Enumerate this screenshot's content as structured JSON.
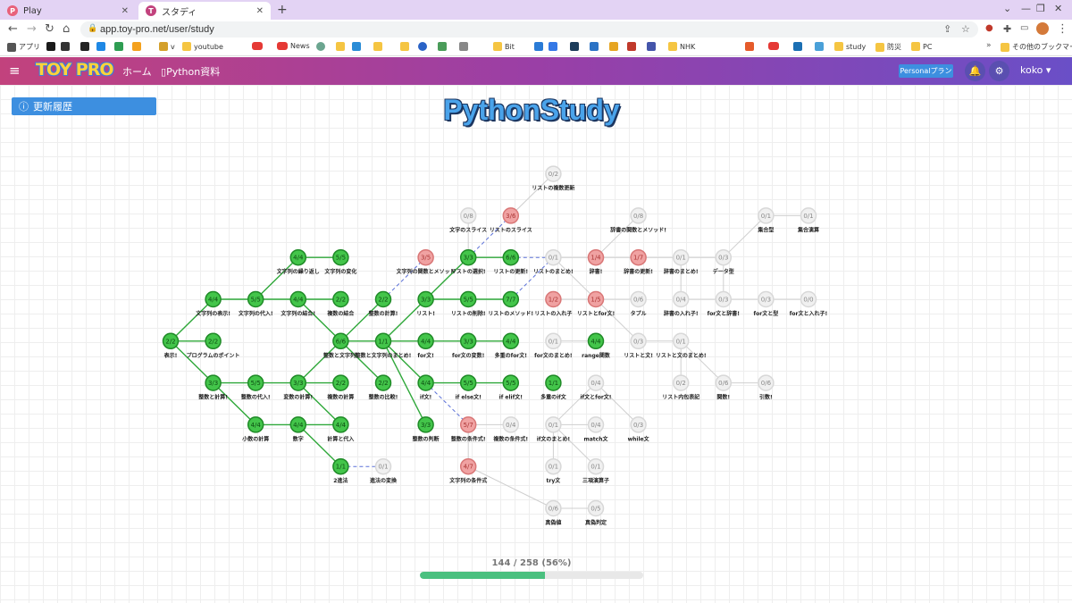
{
  "browser": {
    "tabs": [
      {
        "title": "Play",
        "icon": "play-app-icon",
        "active": false
      },
      {
        "title": "スタディ",
        "icon": "toypro-icon",
        "active": true
      }
    ],
    "url": "app.toy-pro.net/user/study",
    "bookmarks": [
      {
        "label": "アプリ",
        "icon": "apps-grid-icon"
      },
      {
        "label": "",
        "icon": "h-icon"
      },
      {
        "label": "",
        "icon": "amazon-icon"
      },
      {
        "label": "",
        "icon": "wordpress-icon"
      },
      {
        "label": "",
        "icon": "ie-icon"
      },
      {
        "label": "",
        "icon": "sheets-icon"
      },
      {
        "label": "",
        "icon": "star-icon"
      },
      {
        "label": "v",
        "icon": "v-icon"
      },
      {
        "label": "youtube",
        "icon": "folder-icon"
      },
      {
        "label": "",
        "icon": "youtube-icon"
      },
      {
        "label": "News",
        "icon": "youtube-icon"
      },
      {
        "label": "",
        "icon": "chatgpt-icon"
      },
      {
        "label": "",
        "icon": "folder-icon"
      },
      {
        "label": "",
        "icon": "music-icon"
      },
      {
        "label": "",
        "icon": "folder-icon"
      },
      {
        "label": "",
        "icon": "folder-icon"
      },
      {
        "label": "",
        "icon": "globe-icon"
      },
      {
        "label": "",
        "icon": "broadcast-icon"
      },
      {
        "label": "",
        "icon": "apple-icon"
      },
      {
        "label": "Bit",
        "icon": "folder-icon"
      },
      {
        "label": "",
        "icon": "cube-icon"
      },
      {
        "label": "",
        "icon": "translate-icon"
      },
      {
        "label": "",
        "icon": "hex-icon"
      },
      {
        "label": "",
        "icon": "chart-icon"
      },
      {
        "label": "",
        "icon": "pinwheel-icon"
      },
      {
        "label": "",
        "icon": "face-icon"
      },
      {
        "label": "",
        "icon": "person-icon"
      },
      {
        "label": "NHK",
        "icon": "folder-icon"
      },
      {
        "label": "",
        "icon": "fire-icon"
      },
      {
        "label": "",
        "icon": "youtube-icon"
      },
      {
        "label": "",
        "icon": "v-square-icon"
      },
      {
        "label": "",
        "icon": "link-icon"
      },
      {
        "label": "study",
        "icon": "folder-icon"
      },
      {
        "label": "防災",
        "icon": "folder-icon"
      },
      {
        "label": "PC",
        "icon": "folder-icon"
      },
      {
        "label": "その他のブックマーク",
        "icon": "folder-icon"
      }
    ]
  },
  "header": {
    "logo": "TOY PRO",
    "nav": [
      {
        "label": "ホーム"
      },
      {
        "label": "Python資料"
      }
    ],
    "plan_button": "Personalプラン",
    "user": "koko",
    "colors": {
      "gradient_start": "#c2427d",
      "gradient_end": "#6a4fc7",
      "accent": "#3d8fe0"
    }
  },
  "page": {
    "history_button": "更新履歴",
    "title": "PythonStudy",
    "progress": {
      "text": "144 / 258 (56%)",
      "done": 144,
      "total": 258,
      "percent": 56
    }
  },
  "skill_tree": {
    "status_colors": {
      "complete": "#43c54a",
      "partial": "#f0a2a2",
      "locked": "#f0f0f0"
    },
    "nodes": [
      {
        "id": "n1",
        "count": "2/2",
        "label": "表示!",
        "status": "complete",
        "col": 0,
        "row": 6
      },
      {
        "id": "n2",
        "count": "2/2",
        "label": "プログラムのポイント",
        "status": "complete",
        "col": 1,
        "row": 6
      },
      {
        "id": "n3",
        "count": "4/4",
        "label": "文字列の表示!",
        "status": "complete",
        "col": 1,
        "row": 5
      },
      {
        "id": "n4",
        "count": "3/3",
        "label": "整数と計算!",
        "status": "complete",
        "col": 1,
        "row": 7
      },
      {
        "id": "n5",
        "count": "5/5",
        "label": "文字列の代入!",
        "status": "complete",
        "col": 2,
        "row": 5
      },
      {
        "id": "n6",
        "count": "5/5",
        "label": "整数の代入!",
        "status": "complete",
        "col": 2,
        "row": 7
      },
      {
        "id": "n7",
        "count": "4/4",
        "label": "小数の計算",
        "status": "complete",
        "col": 2,
        "row": 8
      },
      {
        "id": "n8",
        "count": "4/4",
        "label": "文字列の繰り返し",
        "status": "complete",
        "col": 3,
        "row": 4
      },
      {
        "id": "n9",
        "count": "4/4",
        "label": "文字列の結合!",
        "status": "complete",
        "col": 3,
        "row": 5
      },
      {
        "id": "n10",
        "count": "3/3",
        "label": "変数の計算!",
        "status": "complete",
        "col": 3,
        "row": 7
      },
      {
        "id": "n11",
        "count": "4/4",
        "label": "数字",
        "status": "complete",
        "col": 3,
        "row": 8
      },
      {
        "id": "n12",
        "count": "5/5",
        "label": "文字列の変化",
        "status": "complete",
        "col": 4,
        "row": 4
      },
      {
        "id": "n13",
        "count": "2/2",
        "label": "複数の結合",
        "status": "complete",
        "col": 4,
        "row": 5
      },
      {
        "id": "n14",
        "count": "6/6",
        "label": "整数と文字列!",
        "status": "complete",
        "col": 4,
        "row": 6
      },
      {
        "id": "n15",
        "count": "2/2",
        "label": "複数の計算",
        "status": "complete",
        "col": 4,
        "row": 7
      },
      {
        "id": "n16",
        "count": "4/4",
        "label": "計算と代入",
        "status": "complete",
        "col": 4,
        "row": 8
      },
      {
        "id": "n17",
        "count": "1/1",
        "label": "2進法",
        "status": "complete",
        "col": 4,
        "row": 9
      },
      {
        "id": "n18",
        "count": "0/1",
        "label": "進法の変換",
        "status": "locked",
        "col": 5,
        "row": 9
      },
      {
        "id": "n19",
        "count": "2/2",
        "label": "整数の計算!",
        "status": "complete",
        "col": 5,
        "row": 5
      },
      {
        "id": "n20",
        "count": "1/1",
        "label": "整数と文字列のまとめ!",
        "status": "complete",
        "col": 5,
        "row": 6
      },
      {
        "id": "n21",
        "count": "2/2",
        "label": "整数の比較!",
        "status": "complete",
        "col": 5,
        "row": 7
      },
      {
        "id": "n22",
        "count": "3/5",
        "label": "文字列の関数とメソッド",
        "status": "partial",
        "col": 6,
        "row": 4
      },
      {
        "id": "n23",
        "count": "3/3",
        "label": "リスト!",
        "status": "complete",
        "col": 6,
        "row": 5
      },
      {
        "id": "n24",
        "count": "4/4",
        "label": "for文!",
        "status": "complete",
        "col": 6,
        "row": 6
      },
      {
        "id": "n25",
        "count": "4/4",
        "label": "if文!",
        "status": "complete",
        "col": 6,
        "row": 7
      },
      {
        "id": "n26",
        "count": "3/3",
        "label": "整数の判断",
        "status": "complete",
        "col": 6,
        "row": 8
      },
      {
        "id": "n27",
        "count": "0/8",
        "label": "文字のスライス",
        "status": "locked",
        "col": 7,
        "row": 3
      },
      {
        "id": "n28",
        "count": "3/3",
        "label": "リストの選択!",
        "status": "complete",
        "col": 7,
        "row": 4
      },
      {
        "id": "n29",
        "count": "5/5",
        "label": "リストの削除!",
        "status": "complete",
        "col": 7,
        "row": 5
      },
      {
        "id": "n30",
        "count": "3/3",
        "label": "for文の変数!",
        "status": "complete",
        "col": 7,
        "row": 6
      },
      {
        "id": "n31",
        "count": "5/5",
        "label": "if else文!",
        "status": "complete",
        "col": 7,
        "row": 7
      },
      {
        "id": "n32",
        "count": "5/7",
        "label": "整数の条件式!",
        "status": "partial",
        "col": 7,
        "row": 8
      },
      {
        "id": "n33",
        "count": "4/7",
        "label": "文字列の条件式",
        "status": "partial",
        "col": 7,
        "row": 9
      },
      {
        "id": "n34",
        "count": "3/6",
        "label": "リストのスライス",
        "status": "partial",
        "col": 8,
        "row": 3
      },
      {
        "id": "n35",
        "count": "6/6",
        "label": "リストの更新!",
        "status": "complete",
        "col": 8,
        "row": 4
      },
      {
        "id": "n36",
        "count": "7/7",
        "label": "リストのメソッド!",
        "status": "complete",
        "col": 8,
        "row": 5
      },
      {
        "id": "n37",
        "count": "4/4",
        "label": "多重のfor文!",
        "status": "complete",
        "col": 8,
        "row": 6
      },
      {
        "id": "n38",
        "count": "5/5",
        "label": "if elif文!",
        "status": "complete",
        "col": 8,
        "row": 7
      },
      {
        "id": "n39",
        "count": "0/4",
        "label": "複数の条件式!",
        "status": "locked",
        "col": 8,
        "row": 8
      },
      {
        "id": "n40",
        "count": "0/2",
        "label": "リストの複数更新",
        "status": "locked",
        "col": 9,
        "row": 2
      },
      {
        "id": "n41",
        "count": "0/1",
        "label": "リストのまとめ!",
        "status": "locked",
        "col": 9,
        "row": 4
      },
      {
        "id": "n42",
        "count": "1/2",
        "label": "リストの入れ子",
        "status": "partial",
        "col": 9,
        "row": 5
      },
      {
        "id": "n43",
        "count": "0/1",
        "label": "for文のまとめ!",
        "status": "locked",
        "col": 9,
        "row": 6
      },
      {
        "id": "n44",
        "count": "1/1",
        "label": "多重のif文",
        "status": "complete",
        "col": 9,
        "row": 7
      },
      {
        "id": "n45",
        "count": "0/1",
        "label": "if文のまとめ!",
        "status": "locked",
        "col": 9,
        "row": 8
      },
      {
        "id": "n46",
        "count": "0/1",
        "label": "try文",
        "status": "locked",
        "col": 9,
        "row": 9
      },
      {
        "id": "n47",
        "count": "0/6",
        "label": "真偽値",
        "status": "locked",
        "col": 9,
        "row": 10
      },
      {
        "id": "n48",
        "count": "1/4",
        "label": "辞書!",
        "status": "partial",
        "col": 10,
        "row": 4
      },
      {
        "id": "n49",
        "count": "1/5",
        "label": "リストとfor文!",
        "status": "partial",
        "col": 10,
        "row": 5
      },
      {
        "id": "n50",
        "count": "4/4",
        "label": "range関数",
        "status": "complete",
        "col": 10,
        "row": 6
      },
      {
        "id": "n51",
        "count": "0/4",
        "label": "if文とfor文!",
        "status": "locked",
        "col": 10,
        "row": 7
      },
      {
        "id": "n52",
        "count": "0/4",
        "label": "match文",
        "status": "locked",
        "col": 10,
        "row": 8
      },
      {
        "id": "n53",
        "count": "0/1",
        "label": "三項演算子",
        "status": "locked",
        "col": 10,
        "row": 9
      },
      {
        "id": "n54",
        "count": "0/5",
        "label": "真偽判定",
        "status": "locked",
        "col": 10,
        "row": 10
      },
      {
        "id": "n55",
        "count": "0/8",
        "label": "辞書の関数とメソッド!",
        "status": "locked",
        "col": 11,
        "row": 3
      },
      {
        "id": "n56",
        "count": "1/7",
        "label": "辞書の更新!",
        "status": "partial",
        "col": 11,
        "row": 4
      },
      {
        "id": "n57",
        "count": "0/6",
        "label": "タプル",
        "status": "locked",
        "col": 11,
        "row": 5
      },
      {
        "id": "n58",
        "count": "0/3",
        "label": "リストと文!",
        "status": "locked",
        "col": 11,
        "row": 6
      },
      {
        "id": "n59",
        "count": "0/3",
        "label": "while文",
        "status": "locked",
        "col": 11,
        "row": 8
      },
      {
        "id": "n60",
        "count": "0/1",
        "label": "辞書のまとめ!",
        "status": "locked",
        "col": 12,
        "row": 4
      },
      {
        "id": "n61",
        "count": "0/4",
        "label": "辞書の入れ子!",
        "status": "locked",
        "col": 12,
        "row": 5
      },
      {
        "id": "n62",
        "count": "0/1",
        "label": "リストと文のまとめ!",
        "status": "locked",
        "col": 12,
        "row": 6
      },
      {
        "id": "n63",
        "count": "0/2",
        "label": "リスト内包表記",
        "status": "locked",
        "col": 12,
        "row": 7
      },
      {
        "id": "n64",
        "count": "0/3",
        "label": "データ型",
        "status": "locked",
        "col": 13,
        "row": 4
      },
      {
        "id": "n65",
        "count": "0/3",
        "label": "for文と辞書!",
        "status": "locked",
        "col": 13,
        "row": 5
      },
      {
        "id": "n66",
        "count": "0/6",
        "label": "関数!",
        "status": "locked",
        "col": 13,
        "row": 7
      },
      {
        "id": "n67",
        "count": "0/1",
        "label": "集合型",
        "status": "locked",
        "col": 14,
        "row": 3
      },
      {
        "id": "n68",
        "count": "0/3",
        "label": "for文と型",
        "status": "locked",
        "col": 14,
        "row": 5
      },
      {
        "id": "n69",
        "count": "0/6",
        "label": "引数!",
        "status": "locked",
        "col": 14,
        "row": 7
      },
      {
        "id": "n70",
        "count": "0/1",
        "label": "集合演算",
        "status": "locked",
        "col": 15,
        "row": 3
      },
      {
        "id": "n71",
        "count": "0/0",
        "label": "for文と入れ子!",
        "status": "locked",
        "col": 15,
        "row": 5
      }
    ],
    "edges": [
      [
        "n1",
        "n3",
        "solid"
      ],
      [
        "n1",
        "n2",
        "solid"
      ],
      [
        "n1",
        "n4",
        "solid"
      ],
      [
        "n3",
        "n5",
        "solid"
      ],
      [
        "n4",
        "n6",
        "solid"
      ],
      [
        "n4",
        "n7",
        "solid"
      ],
      [
        "n5",
        "n8",
        "solid"
      ],
      [
        "n5",
        "n9",
        "solid"
      ],
      [
        "n6",
        "n10",
        "solid"
      ],
      [
        "n7",
        "n11",
        "solid"
      ],
      [
        "n8",
        "n12",
        "solid"
      ],
      [
        "n9",
        "n13",
        "solid"
      ],
      [
        "n9",
        "n14",
        "solid"
      ],
      [
        "n10",
        "n14",
        "solid"
      ],
      [
        "n10",
        "n15",
        "solid"
      ],
      [
        "n10",
        "n16",
        "solid"
      ],
      [
        "n11",
        "n17",
        "solid"
      ],
      [
        "n17",
        "n18",
        "dashed"
      ],
      [
        "n14",
        "n19",
        "solid"
      ],
      [
        "n14",
        "n20",
        "solid"
      ],
      [
        "n14",
        "n21",
        "solid"
      ],
      [
        "n11",
        "n16",
        "solid"
      ],
      [
        "n20",
        "n23",
        "solid"
      ],
      [
        "n20",
        "n24",
        "solid"
      ],
      [
        "n20",
        "n25",
        "solid"
      ],
      [
        "n20",
        "n26",
        "solid"
      ],
      [
        "n19",
        "n22",
        "dashed"
      ],
      [
        "n23",
        "n28",
        "solid"
      ],
      [
        "n23",
        "n29",
        "solid"
      ],
      [
        "n24",
        "n30",
        "solid"
      ],
      [
        "n25",
        "n31",
        "solid"
      ],
      [
        "n25",
        "n32",
        "dashed"
      ],
      [
        "n32",
        "n33",
        "solid"
      ],
      [
        "n32",
        "n39",
        "solid"
      ],
      [
        "n28",
        "n27",
        "solid"
      ],
      [
        "n28",
        "n34",
        "dashed"
      ],
      [
        "n28",
        "n35",
        "solid"
      ],
      [
        "n29",
        "n36",
        "solid"
      ],
      [
        "n30",
        "n37",
        "solid"
      ],
      [
        "n31",
        "n38",
        "solid"
      ],
      [
        "n34",
        "n40",
        "solid"
      ],
      [
        "n35",
        "n41",
        "dashed"
      ],
      [
        "n36",
        "n41",
        "dashed"
      ],
      [
        "n41",
        "n48",
        "solid"
      ],
      [
        "n41",
        "n49",
        "solid"
      ],
      [
        "n42",
        "n49",
        "solid"
      ],
      [
        "n43",
        "n50",
        "solid"
      ],
      [
        "n45",
        "n51",
        "solid"
      ],
      [
        "n45",
        "n52",
        "solid"
      ],
      [
        "n45",
        "n46",
        "solid"
      ],
      [
        "n45",
        "n53",
        "solid"
      ],
      [
        "n33",
        "n47",
        "solid"
      ],
      [
        "n47",
        "n54",
        "solid"
      ],
      [
        "n48",
        "n56",
        "solid"
      ],
      [
        "n48",
        "n55",
        "solid"
      ],
      [
        "n49",
        "n57",
        "solid"
      ],
      [
        "n49",
        "n58",
        "solid"
      ],
      [
        "n51",
        "n59",
        "solid"
      ],
      [
        "n56",
        "n60",
        "solid"
      ],
      [
        "n60",
        "n64",
        "solid"
      ],
      [
        "n60",
        "n61",
        "solid"
      ],
      [
        "n58",
        "n62",
        "solid"
      ],
      [
        "n62",
        "n63",
        "solid"
      ],
      [
        "n61",
        "n65",
        "solid"
      ],
      [
        "n64",
        "n65",
        "solid"
      ],
      [
        "n65",
        "n68",
        "solid"
      ],
      [
        "n68",
        "n71",
        "solid"
      ],
      [
        "n66",
        "n69",
        "solid"
      ],
      [
        "n67",
        "n70",
        "solid"
      ],
      [
        "n64",
        "n67",
        "solid"
      ],
      [
        "n62",
        "n66",
        "solid"
      ]
    ]
  }
}
